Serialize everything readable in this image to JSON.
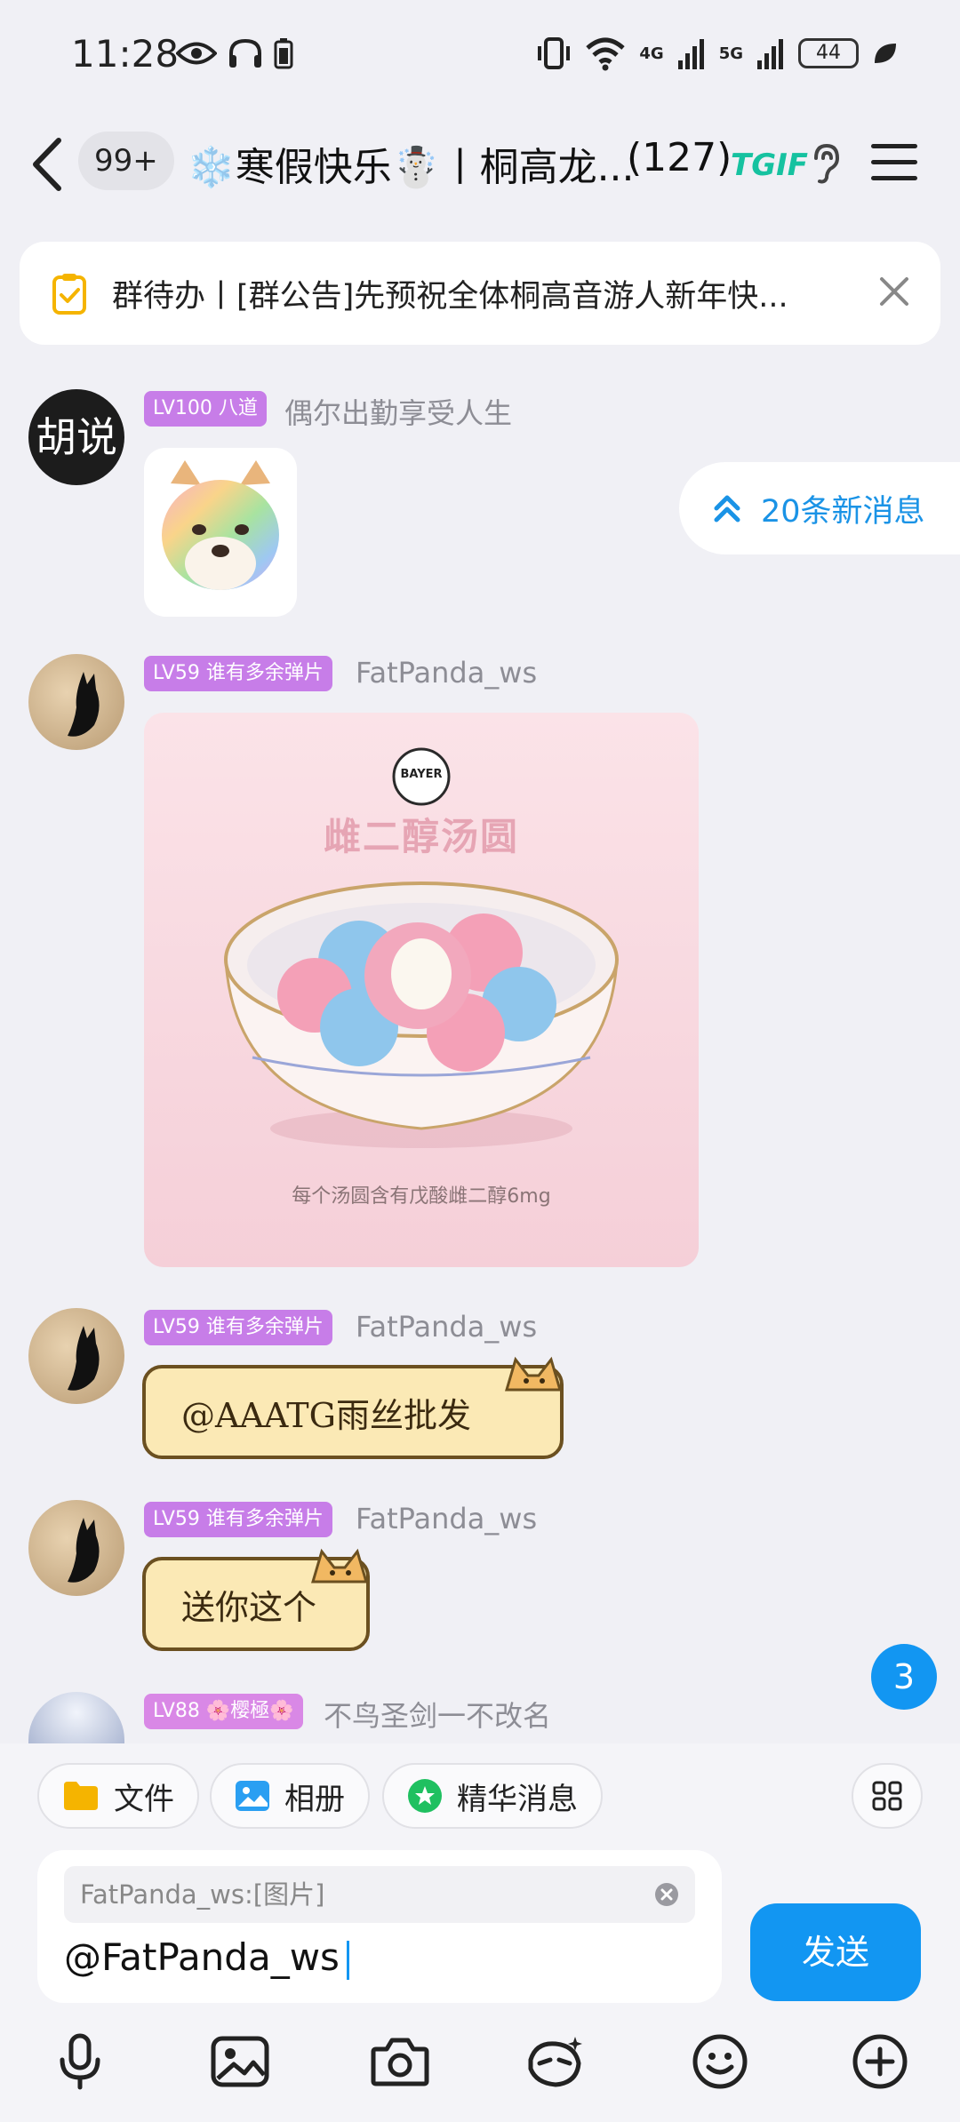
{
  "status_bar": {
    "time": "11:28",
    "net1": "4G",
    "net2": "5G",
    "battery": "44"
  },
  "header": {
    "unread": "99+",
    "title": "❄️寒假快乐☃️丨桐高龙...",
    "member_count": "(127)",
    "logo_text": "TGIF"
  },
  "notice": {
    "text": "群待办丨[群公告]先预祝全体桐高音游人新年快..."
  },
  "new_messages": {
    "label": "20条新消息"
  },
  "messages": [
    {
      "level": "LV100 八道",
      "sender": "偶尔出勤享受人生",
      "avatar_text": "胡说"
    },
    {
      "level": "LV59 谁有多余弹片",
      "sender": "FatPanda_ws",
      "image_logo": "BAYER",
      "image_title": "雌二醇汤圆",
      "image_caption": "每个汤圆含有戊酸雌二醇6mg"
    },
    {
      "level": "LV59 谁有多余弹片",
      "sender": "FatPanda_ws",
      "sticker_text": "@AAATG雨丝批发"
    },
    {
      "level": "LV59 谁有多余弹片",
      "sender": "FatPanda_ws",
      "sticker_text": "送你这个"
    },
    {
      "level": "LV88 🌸樱極🌸",
      "sender": "不鸟圣剑一不改名"
    }
  ],
  "unread_mentions": "3",
  "quick_actions": [
    {
      "label": "文件",
      "icon": "folder-icon"
    },
    {
      "label": "相册",
      "icon": "photo-icon"
    },
    {
      "label": "精华消息",
      "icon": "star-icon"
    }
  ],
  "composer": {
    "reply_quote": "FatPanda_ws:[图片]",
    "value": "@FatPanda_ws",
    "send_label": "发送"
  },
  "toolbar_icons": [
    "microphone-icon",
    "image-icon",
    "camera-icon",
    "magic-icon",
    "emoji-icon",
    "plus-icon"
  ],
  "colors": {
    "accent": "#1296f2",
    "level_tag": "#c77de8",
    "background": "#f0f0f5"
  }
}
